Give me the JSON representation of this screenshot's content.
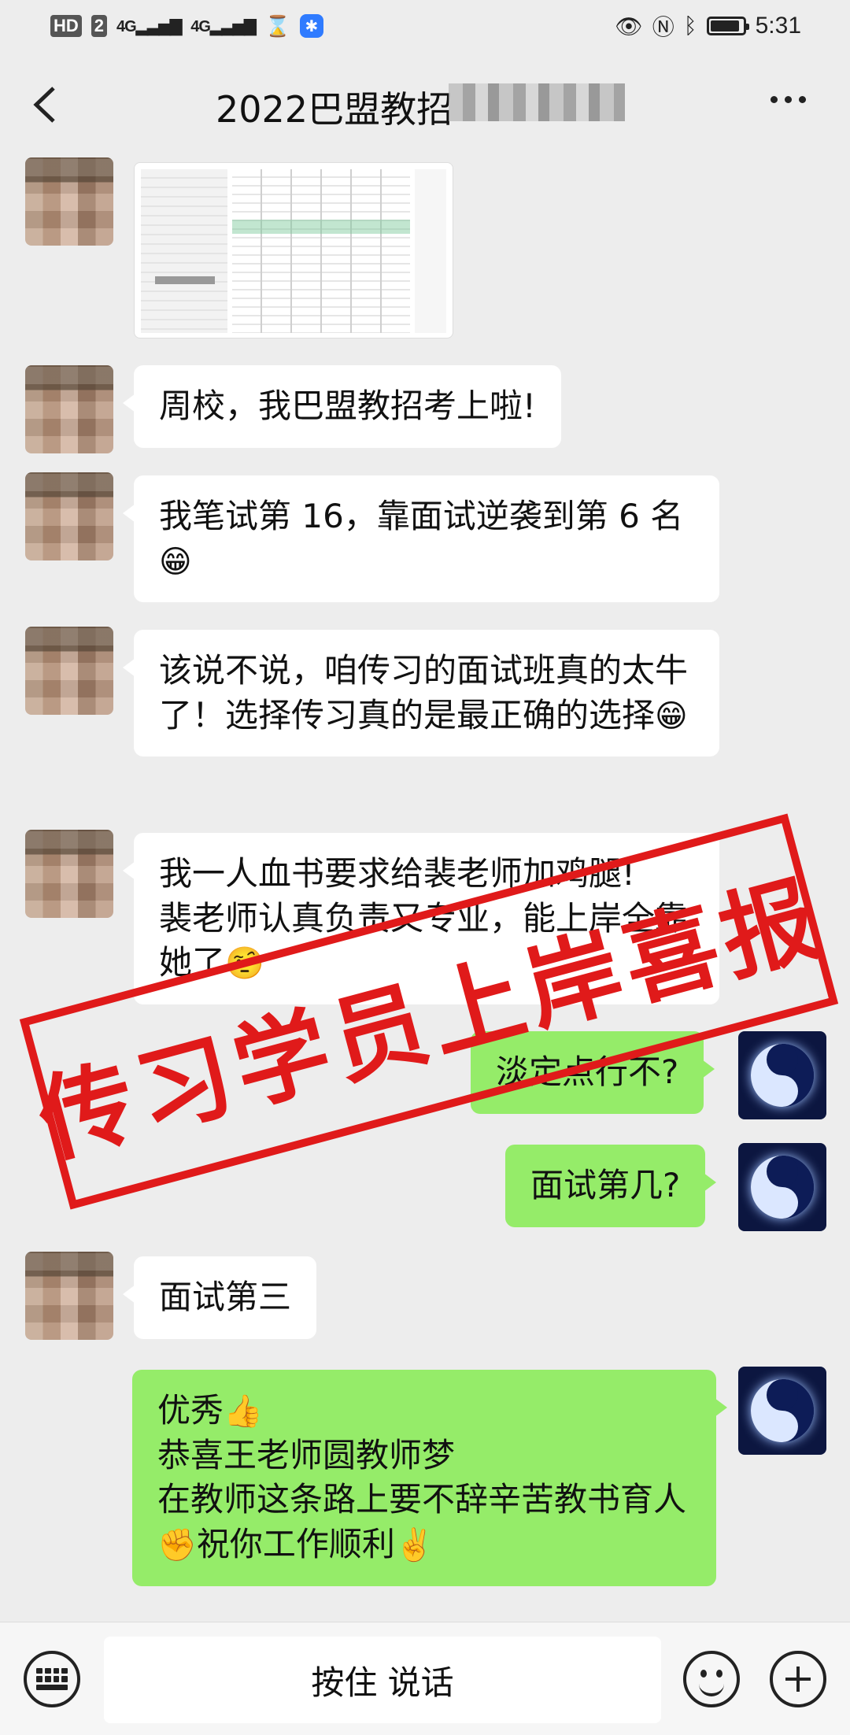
{
  "status_bar": {
    "hd_label": "HD",
    "sim_label": "2",
    "signal1": "4G",
    "signal2": "4G",
    "time": "5:31",
    "icons": [
      "hd-icon",
      "signal-icon",
      "signal-icon",
      "hourglass-icon",
      "app-notification-icon",
      "eye-icon",
      "nfc-icon",
      "bluetooth-icon",
      "battery-icon"
    ],
    "battery_level": 0.9
  },
  "header": {
    "title": "2022巴盟教招",
    "back_icon": "chevron-left-icon",
    "more_icon": "ellipsis-icon"
  },
  "messages": [
    {
      "side": "left",
      "type": "image",
      "label": ""
    },
    {
      "side": "left",
      "type": "text",
      "text": "周校，我巴盟教招考上啦!"
    },
    {
      "side": "left",
      "type": "text",
      "text": "我笔试第 16，靠面试逆袭到第 6 名",
      "emoji_after": "😁"
    },
    {
      "side": "left",
      "type": "text",
      "text": "该说不说，咱传习的面试班真的太牛了！选择传习真的是最正确的选择",
      "emoji_after": "😁"
    },
    {
      "side": "left",
      "type": "text",
      "text": "我一人血书要求给裴老师加鸡腿!\n裴老师认真负责又专业，能上岸全靠她了",
      "emoji_after": "🤨"
    },
    {
      "side": "right",
      "type": "text",
      "text": "淡定点行不?"
    },
    {
      "side": "right",
      "type": "text",
      "text": "面试第几?"
    },
    {
      "side": "left",
      "type": "text",
      "text": "面试第三"
    },
    {
      "side": "right",
      "type": "text",
      "line1": "优秀",
      "emoji1": "👍",
      "line2": "恭喜王老师圆教师梦",
      "line3": "在教师这条路上要不辞辛苦教书育人",
      "emoji2": "✊",
      "line3b": "祝你工作顺利",
      "emoji3": "✌️"
    }
  ],
  "stamp": {
    "text": "传习学员上岸喜报"
  },
  "bottom_bar": {
    "talk_label": "按住 说话",
    "icons": [
      "keyboard-icon",
      "emoji-icon",
      "plus-icon"
    ]
  }
}
